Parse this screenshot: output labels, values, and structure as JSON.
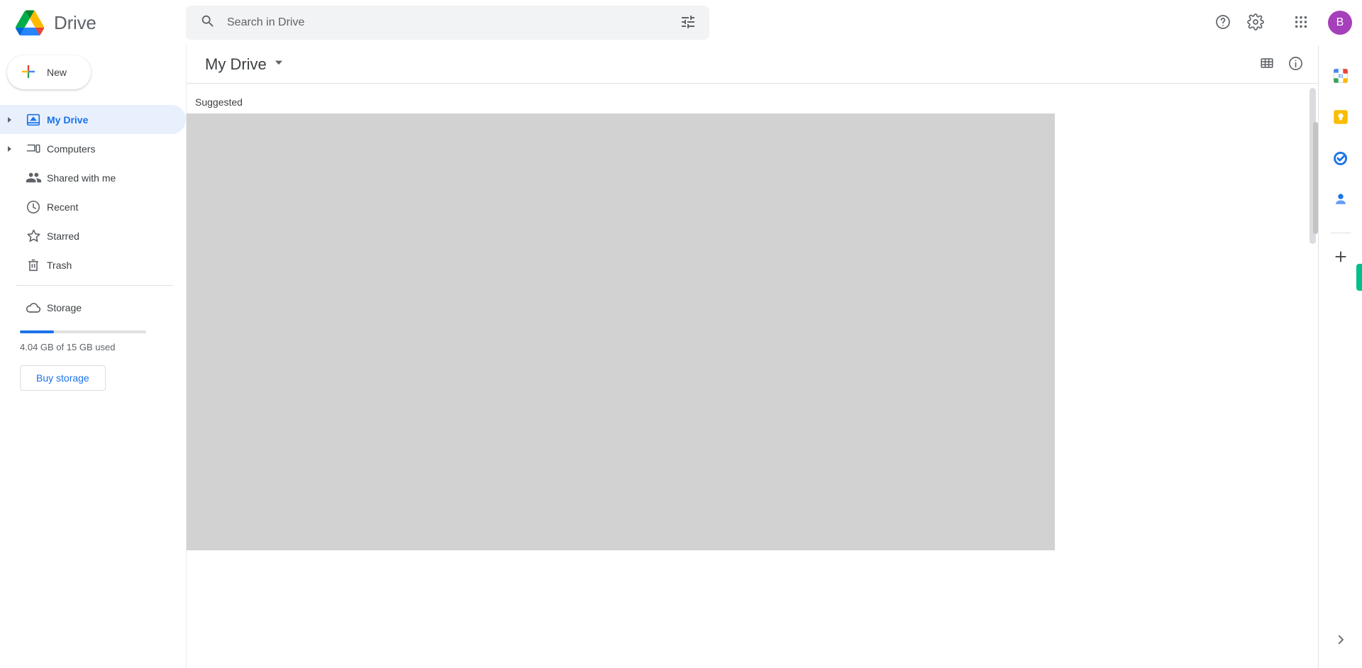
{
  "app": {
    "name": "Drive",
    "logo_icon": "google-drive-logo"
  },
  "search": {
    "placeholder": "Search in Drive",
    "value": "",
    "search_icon": "search-icon",
    "filter_icon": "tune-filter-icon"
  },
  "topbar": {
    "help_icon": "help-circle-icon",
    "settings_icon": "gear-icon",
    "apps_icon": "apps-grid-icon",
    "avatar_initial": "B",
    "avatar_color": "#a63fba"
  },
  "sidebar": {
    "new_button": {
      "label": "New",
      "icon": "plus-icon"
    },
    "items": [
      {
        "label": "My Drive",
        "icon": "my-drive-icon",
        "expandable": true,
        "active": true
      },
      {
        "label": "Computers",
        "icon": "computers-icon",
        "expandable": true,
        "active": false
      },
      {
        "label": "Shared with me",
        "icon": "shared-with-me-icon",
        "expandable": false,
        "active": false
      },
      {
        "label": "Recent",
        "icon": "clock-icon",
        "expandable": false,
        "active": false
      },
      {
        "label": "Starred",
        "icon": "star-icon",
        "expandable": false,
        "active": false
      },
      {
        "label": "Trash",
        "icon": "trash-icon",
        "expandable": false,
        "active": false
      }
    ],
    "storage": {
      "label": "Storage",
      "icon": "cloud-icon",
      "used_text": "4.04 GB of 15 GB used",
      "used_percent": 27,
      "bar_color": "#1a73e8",
      "buy_button_label": "Buy storage"
    }
  },
  "main": {
    "breadcrumb": "My Drive",
    "breadcrumb_caret": "chevron-down-icon",
    "grid_view_icon": "grid-view-icon",
    "info_icon": "info-circle-icon",
    "section_label": "Suggested"
  },
  "right_panel": {
    "apps": [
      {
        "name": "google-calendar-icon",
        "label": "31"
      },
      {
        "name": "google-keep-icon",
        "label": ""
      },
      {
        "name": "google-tasks-icon",
        "label": ""
      },
      {
        "name": "google-contacts-icon",
        "label": ""
      }
    ],
    "add_icon": "plus-icon",
    "expand_icon": "chevron-right-icon",
    "accent_tab_color": "#00c08b"
  }
}
